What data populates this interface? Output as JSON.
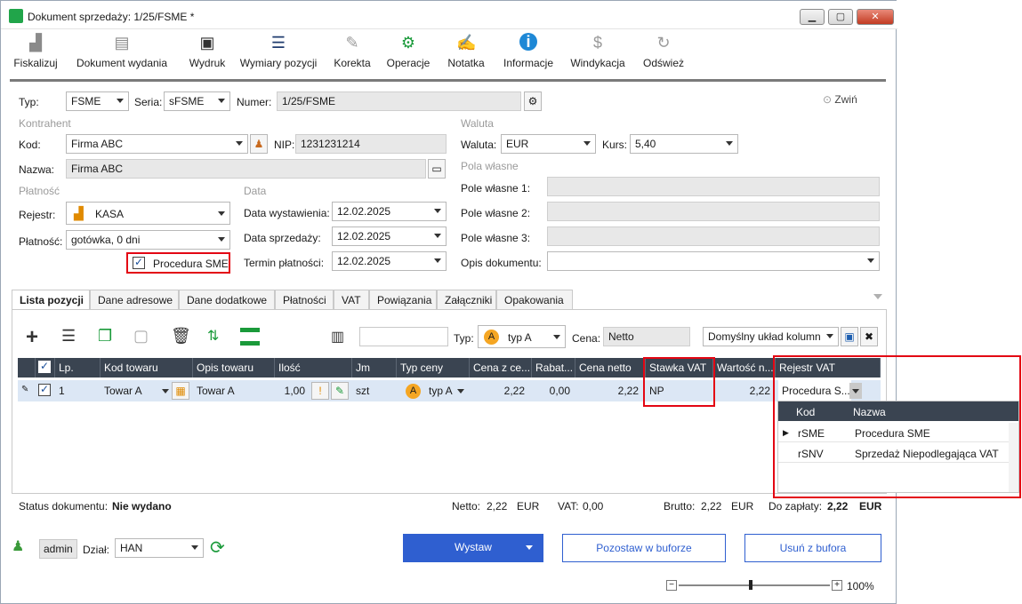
{
  "window": {
    "title": "Dokument sprzedaży: 1/25/FSME *",
    "minimize": "▁",
    "maximize": "▢",
    "close": "✕"
  },
  "toolbar": [
    {
      "label": "Fiskalizuj",
      "icon": "cash-register-icon"
    },
    {
      "label": "Dokument wydania",
      "icon": "document-export-icon"
    },
    {
      "label": "Wydruk",
      "icon": "printer-icon"
    },
    {
      "label": "Wymiary pozycji",
      "icon": "list-icon"
    },
    {
      "label": "Korekta",
      "icon": "pencil-icon"
    },
    {
      "label": "Operacje",
      "icon": "gears-icon"
    },
    {
      "label": "Notatka",
      "icon": "note-icon"
    },
    {
      "label": "Informacje",
      "icon": "info-icon"
    },
    {
      "label": "Windykacja",
      "icon": "money-hand-icon"
    },
    {
      "label": "Odśwież",
      "icon": "refresh-icon"
    }
  ],
  "header": {
    "typ_label": "Typ:",
    "typ_value": "FSME",
    "seria_label": "Seria:",
    "seria_value": "sFSME",
    "numer_label": "Numer:",
    "numer_value": "1/25/FSME",
    "collapse_label": "Zwiń"
  },
  "kontrahent": {
    "section": "Kontrahent",
    "kod_label": "Kod:",
    "kod_value": "Firma ABC",
    "nip_label": "NIP:",
    "nip_value": "1231231214",
    "nazwa_label": "Nazwa:",
    "nazwa_value": "Firma ABC"
  },
  "waluta": {
    "section": "Waluta",
    "waluta_label": "Waluta:",
    "waluta_value": "EUR",
    "kurs_label": "Kurs:",
    "kurs_value": "5,40"
  },
  "pola_wlasne": {
    "section": "Pola własne",
    "field1_label": "Pole własne 1:",
    "field2_label": "Pole własne 2:",
    "field3_label": "Pole własne 3:",
    "opis_label": "Opis dokumentu:"
  },
  "platnosc": {
    "section": "Płatność",
    "rejestr_label": "Rejestr:",
    "rejestr_value": "KASA",
    "platnosc_label": "Płatność:",
    "platnosc_value": "gotówka, 0 dni",
    "procedura_label": "Procedura SME",
    "procedura_checked": "✓"
  },
  "data": {
    "section": "Data",
    "wystawienia_label": "Data wystawienia:",
    "wystawienia_value": "12.02.2025",
    "sprzedazy_label": "Data sprzedaży:",
    "sprzedazy_value": "12.02.2025",
    "termin_label": "Termin płatności:",
    "termin_value": "12.02.2025"
  },
  "tabs": [
    "Lista pozycji",
    "Dane adresowe",
    "Dane dodatkowe",
    "Płatności",
    "VAT",
    "Powiązania",
    "Załączniki",
    "Opakowania"
  ],
  "grid_toolbar": {
    "typ_label": "Typ:",
    "typ_value": "typ A",
    "typ_badge": "A",
    "cena_label": "Cena:",
    "cena_value": "Netto",
    "layout_value": "Domyślny układ kolumn"
  },
  "grid": {
    "columns": [
      "Lp.",
      "Kod towaru",
      "Opis towaru",
      "Ilość",
      "Jm",
      "Typ ceny",
      "Cena z ce...",
      "Rabat...",
      "Cena netto",
      "Stawka VAT",
      "Wartość n...",
      "Rejestr VAT"
    ],
    "row": {
      "lp": "1",
      "kod": "Towar A",
      "opis": "Towar A",
      "ilosc": "1,00",
      "jm": "szt",
      "typ_badge": "A",
      "typ": "typ A",
      "cena_z": "2,22",
      "rabat": "0,00",
      "cena_netto": "2,22",
      "stawka": "NP",
      "wartosc": "2,22",
      "rejestr": "Procedura S..."
    }
  },
  "vat_dropdown": {
    "headers": [
      "Kod",
      "Nazwa"
    ],
    "rows": [
      {
        "kod": "rSME",
        "nazwa": "Procedura SME"
      },
      {
        "kod": "rSNV",
        "nazwa": "Sprzedaż Niepodlegająca VAT"
      }
    ]
  },
  "status": {
    "status_label": "Status dokumentu:",
    "status_value": "Nie wydano",
    "netto_label": "Netto:",
    "netto_value": "2,22",
    "netto_currency": "EUR",
    "vat_label": "VAT:",
    "vat_value": "0,00",
    "brutto_label": "Brutto:",
    "brutto_value": "2,22",
    "brutto_currency": "EUR",
    "zaplata_label": "Do zapłaty:",
    "zaplata_value": "2,22",
    "zaplata_currency": "EUR"
  },
  "footer": {
    "user": "admin",
    "dzial_label": "Dział:",
    "dzial_value": "HAN",
    "wystaw": "Wystaw",
    "pozostaw": "Pozostaw w buforze",
    "usun": "Usuń z bufora",
    "zoom": "100%",
    "zoom_level": 1.0
  },
  "colors": {
    "accent_blue": "#2f5fd0",
    "red_highlight": "#e30613",
    "grid_header": "#3a4451",
    "selected_row": "#dce7f5"
  }
}
